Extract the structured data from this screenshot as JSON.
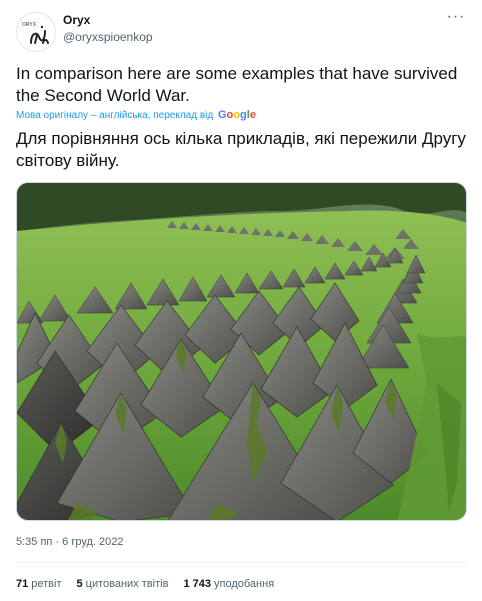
{
  "author": {
    "name": "Oryx",
    "handle": "@oryxspioenkop",
    "avatar_icon": "oryx-logo-icon",
    "avatar_text": "ORYX"
  },
  "more_icon": "ellipsis-icon",
  "more_label": "···",
  "tweet": {
    "text_original": "In comparison here are some examples that have survived the Second World War.",
    "translation_note": "Мова оригіналу – англійська, переклад від",
    "translation_provider": "Google",
    "text_translated": "Для порівняння ось кілька прикладів, які пережили Другу світову війну.",
    "photo_icon": "dragon-teeth-photo"
  },
  "timestamp": "5:35 пп · 6 груд. 2022",
  "stats": {
    "retweets_count": "71",
    "retweets_label": "ретвіт",
    "quotes_count": "5",
    "quotes_label": "цитованих твітів",
    "likes_count": "1 743",
    "likes_label": "уподобання"
  },
  "colors": {
    "link": "#1d9bf0",
    "secondary_text": "#536471",
    "primary_text": "#0f1419"
  }
}
